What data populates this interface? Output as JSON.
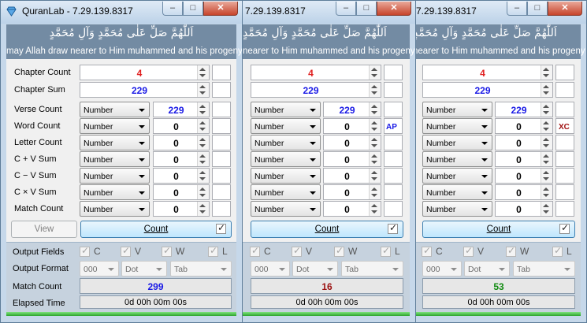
{
  "app": {
    "title": "QuranLab - 7.29.139.8317",
    "title_partial": "7.29.139.8317",
    "header_arabic": "اَللّٰهُمَّ صَلِّ عَلٰى مُحَمَّدٍ وَآلِ مُحَمَّدٍ",
    "header_english": "may Allah draw nearer to Him muhammed and his progeny",
    "header_english_partial": "nearer to Him muhammed and his progeny",
    "window_buttons": [
      "‒",
      "□",
      "✕"
    ]
  },
  "labels": {
    "chapter_count": "Chapter Count",
    "chapter_sum": "Chapter Sum",
    "verse_count": "Verse Count",
    "word_count": "Word Count",
    "letter_count": "Letter Count",
    "c_plus_v": "C + V  Sum",
    "c_minus_v": "C − V  Sum",
    "c_times_v": "C × V  Sum",
    "match_count": "Match Count",
    "output_fields": "Output Fields",
    "output_format": "Output Format",
    "match_count_result": "Match Count",
    "elapsed_time": "Elapsed Time"
  },
  "buttons": {
    "view": "View",
    "count": "Count"
  },
  "combo_text": "Number",
  "output_field_names": [
    "C",
    "V",
    "W",
    "L"
  ],
  "output_format": {
    "base": "000",
    "point": "Dot",
    "separator": "Tab"
  },
  "chapter_count": "4",
  "chapter_sum": "229",
  "row_values": [
    "229",
    "0",
    "0",
    "0",
    "0",
    "0",
    "0"
  ],
  "elapsed": "0d 00h 00m 00s",
  "windows": [
    {
      "extra_label": "",
      "match_count": "299"
    },
    {
      "extra_label": "AP",
      "match_count": "16"
    },
    {
      "extra_label": "XC",
      "match_count": "53"
    }
  ],
  "colors": {
    "chapter_count": "#e02020",
    "chapter_sum": "#1a1ae6",
    "verse_count": "#1a1ae6",
    "ap": "#1a1ae6",
    "xc": "#a01010",
    "match": [
      "#1a1ae6",
      "#9b1111",
      "#118b11"
    ]
  }
}
